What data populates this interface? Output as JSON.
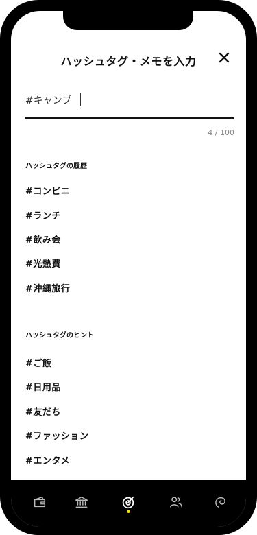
{
  "header": {
    "title": "ハッシュタグ・メモを入力",
    "close_icon": "close-icon"
  },
  "memo": {
    "value": "#キャンプ",
    "counter": "4 / 100"
  },
  "history": {
    "title": "ハッシュタグの履歴",
    "tags": [
      "#コンビニ",
      "#ランチ",
      "#飲み会",
      "#光熱費",
      "#沖縄旅行"
    ]
  },
  "hints": {
    "title": "ハッシュタグのヒント",
    "tags": [
      "#ご飯",
      "#日用品",
      "#友だち",
      "#ファッション",
      "#エンタメ"
    ]
  },
  "tabbar": {
    "tabs": [
      {
        "icon": "wallet-icon"
      },
      {
        "icon": "bank-icon"
      },
      {
        "icon": "target-icon",
        "active": true
      },
      {
        "icon": "people-icon"
      },
      {
        "icon": "swirl-icon"
      }
    ],
    "active_color": "#f2e300"
  }
}
